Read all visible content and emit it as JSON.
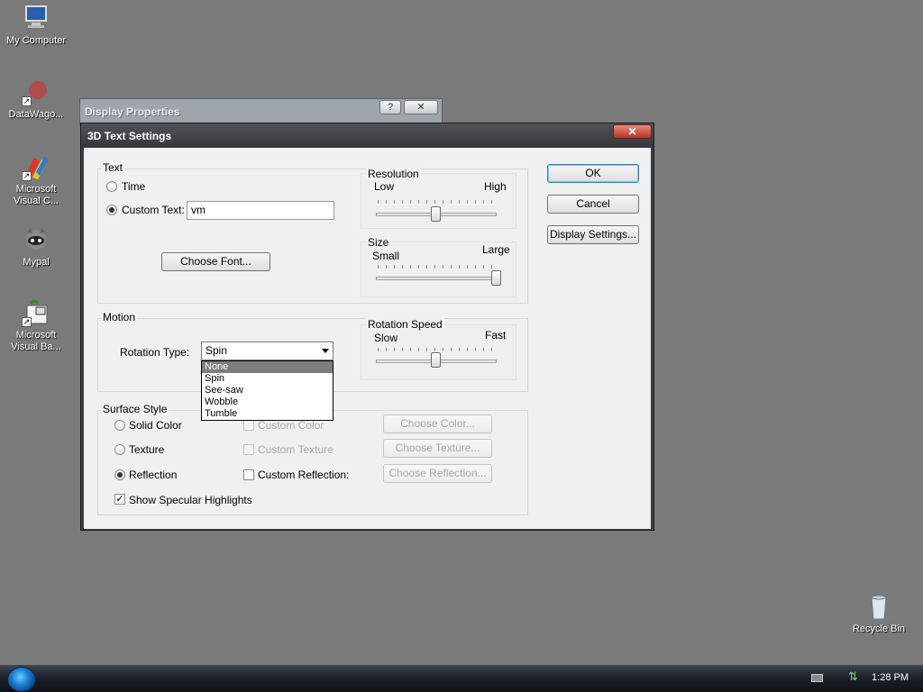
{
  "desktop": {
    "icons": [
      {
        "label": "My Computer",
        "icon": "computer-icon"
      },
      {
        "label": "DataWago...",
        "icon": "datawagon-icon"
      },
      {
        "label": "Microsoft Visual C...",
        "icon": "visual-c-icon"
      },
      {
        "label": "Mypal",
        "icon": "mypal-icon"
      },
      {
        "label": "Microsoft Visual Ba...",
        "icon": "visual-basic-icon"
      },
      {
        "label": "Recycle Bin",
        "icon": "recycle-bin-icon"
      }
    ]
  },
  "taskbar": {
    "clock": "1:28 PM",
    "start_icon": "windows-start-orb"
  },
  "background_window": {
    "title": "Display Properties",
    "help_glyph": "?",
    "close_glyph": "✕"
  },
  "dialog": {
    "title": "3D Text Settings",
    "close_glyph": "✕",
    "text_group": {
      "label": "Text",
      "time_label": "Time",
      "custom_text_label": "Custom Text:",
      "custom_text_value": "vm",
      "choose_font": "Choose Font..."
    },
    "resolution": {
      "label": "Resolution",
      "low": "Low",
      "high": "High",
      "level": 0.5
    },
    "size": {
      "label": "Size",
      "small": "Small",
      "large": "Large",
      "level": 1.0
    },
    "motion_group": {
      "label": "Motion",
      "rotation_type_label": "Rotation Type:",
      "rotation_type_value": "Spin",
      "options": [
        "None",
        "Spin",
        "See-saw",
        "Wobble",
        "Tumble"
      ],
      "highlighted_option": "None"
    },
    "rotation_speed": {
      "label": "Rotation Speed",
      "slow": "Slow",
      "fast": "Fast",
      "level": 0.5
    },
    "surface_group": {
      "label": "Surface Style",
      "solid_color": "Solid Color",
      "texture": "Texture",
      "reflection": "Reflection",
      "custom_color": "Custom Color",
      "custom_texture": "Custom Texture",
      "custom_reflection": "Custom Reflection:",
      "choose_color": "Choose Color...",
      "choose_texture": "Choose Texture...",
      "choose_reflection": "Choose Reflection...",
      "specular": "Show Specular Highlights",
      "specular_checked": true
    },
    "buttons": {
      "ok": "OK",
      "cancel": "Cancel",
      "display_settings": "Display Settings..."
    }
  }
}
